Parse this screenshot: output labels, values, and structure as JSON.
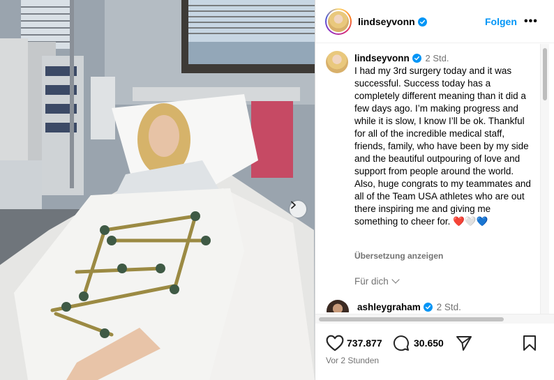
{
  "post": {
    "username": "lindseyvonn",
    "follow_label": "Folgen",
    "more_label": "•••",
    "caption": {
      "username": "lindseyvonn",
      "time": "2 Std.",
      "text": "I had my 3rd surgery today and it was successful. Success today has a completely different meaning than it did a few days ago. I’m making progress and while it is slow, I know I’ll be ok. Thankful for all of the incredible medical staff, friends, family, who have been by my side and the beautiful outpouring of love and support from people around the world. Also, huge congrats to my teammates and all of the Team USA athletes who are out there inspiring me and giving me something to cheer for.",
      "emojis": [
        "❤️",
        "🤍",
        "💙"
      ],
      "translate_label": "Übersetzung anzeigen"
    },
    "for_you_label": "Für dich",
    "next_comment": {
      "username": "ashleygraham",
      "time": "2 Std."
    },
    "likes": "737.877",
    "comments_count": "30.650",
    "posted_ago": "Vor 2 Stunden"
  },
  "colors": {
    "accent": "#0095f6",
    "secondary_text": "#737373",
    "verified": "#0095f6"
  },
  "icons": [
    "chevron-right-icon",
    "verified-icon",
    "heart-icon",
    "comment-icon",
    "share-icon",
    "bookmark-icon",
    "chevron-down-icon"
  ]
}
